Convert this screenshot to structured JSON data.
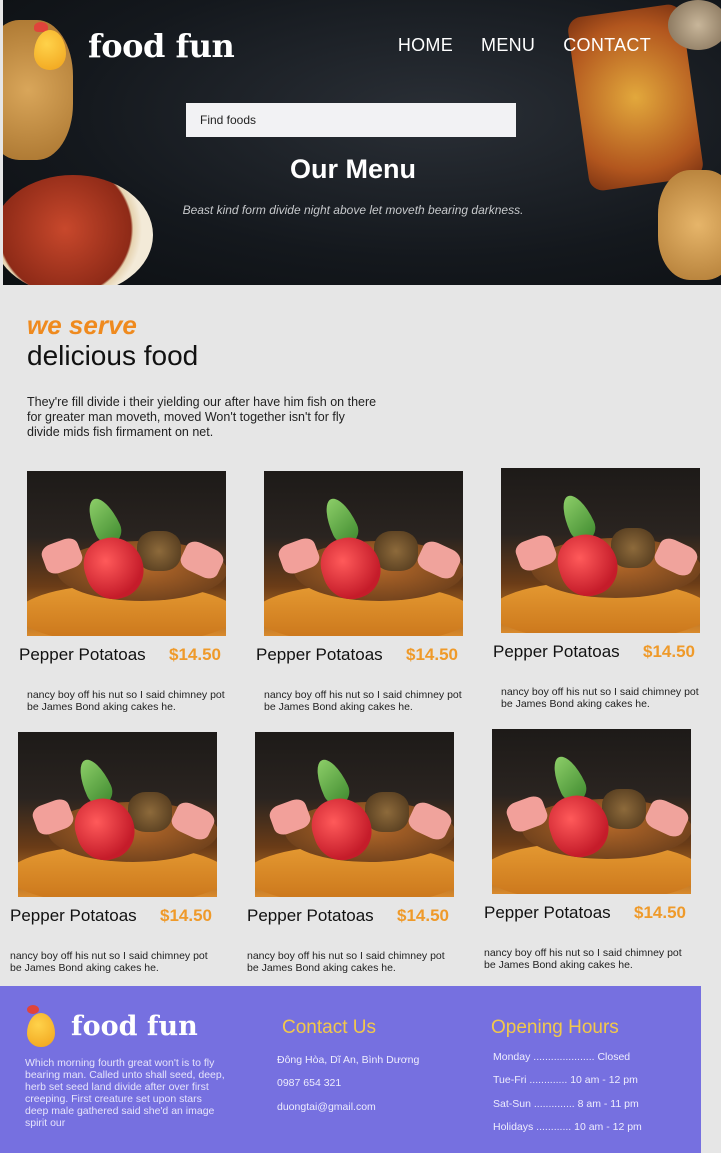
{
  "brand": {
    "name": "food fun"
  },
  "nav": {
    "home": "HOME",
    "menu": "MENU",
    "contact": "CONTACT"
  },
  "hero": {
    "search_placeholder": "Find foods",
    "title": "Our Menu",
    "subtitle": "Beast kind form divide night above let moveth bearing darkness."
  },
  "serve": {
    "kicker": "we serve",
    "title": "delicious food",
    "description": "They're fill divide i their yielding our after have him fish on there for greater man moveth, moved Won't together isn't for fly divide mids fish firmament on net."
  },
  "menu_items": [
    {
      "name": "Pepper Potatoas",
      "price": "$14.50",
      "description": "nancy boy off his nut so I said chimney pot be James Bond aking cakes he."
    },
    {
      "name": "Pepper Potatoas",
      "price": "$14.50",
      "description": "nancy boy off his nut so I said chimney pot be James Bond aking cakes he."
    },
    {
      "name": "Pepper Potatoas",
      "price": "$14.50",
      "description": "nancy boy off his nut so I said chimney pot be James Bond aking cakes he."
    },
    {
      "name": "Pepper Potatoas",
      "price": "$14.50",
      "description": "nancy boy off his nut so I said chimney pot be James Bond aking cakes he."
    },
    {
      "name": "Pepper Potatoas",
      "price": "$14.50",
      "description": "nancy boy off his nut so I said chimney pot be James Bond aking cakes he."
    },
    {
      "name": "Pepper Potatoas",
      "price": "$14.50",
      "description": "nancy boy off his nut so I said chimney pot be James Bond aking cakes he."
    }
  ],
  "footer": {
    "about": "Which morning fourth great won't is to fly bearing man. Called unto shall seed, deep, herb set seed land divide after over first creeping. First creature set upon stars deep male gathered said she'd an image spirit our",
    "contact_title": "Contact Us",
    "address": "Đông Hòa, Dĩ An, Bình Dương",
    "phone": "0987 654 321",
    "email": "duongtai@gmail.com",
    "hours_title": "Opening Hours",
    "hours": [
      "Monday ..................... Closed",
      "Tue-Fri ............. 10 am - 12 pm",
      "Sat-Sun .............. 8 am - 11 pm",
      "Holidays ............ 10 am - 12 pm"
    ]
  },
  "colors": {
    "accent": "#ef8a1e",
    "price": "#ef9a2a",
    "footer_bg": "#7670e0",
    "footer_heading": "#f2c84b"
  }
}
